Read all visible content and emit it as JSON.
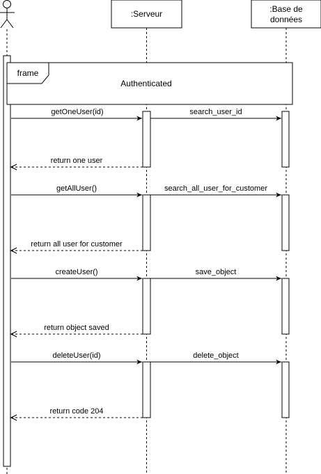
{
  "participants": {
    "actor": {
      "label": "",
      "icon": "stick-figure-icon"
    },
    "server": {
      "label": ":Serveur"
    },
    "database": {
      "label_line1": ":Base de",
      "label_line2": "données"
    }
  },
  "frame": {
    "tag": "frame",
    "title": "Authenticated"
  },
  "messages": [
    {
      "call": "getOneUser(id)",
      "forward": "search_user_id",
      "reply": "return one user"
    },
    {
      "call": "getAllUser()",
      "forward": "search_all_user_for_customer",
      "reply": "return all user for customer"
    },
    {
      "call": "createUser()",
      "forward": "save_object",
      "reply": "return object saved"
    },
    {
      "call": "deleteUser(id)",
      "forward": "delete_object",
      "reply": "return code 204"
    }
  ],
  "colors": {
    "line": "#000000",
    "background": "#ffffff"
  }
}
